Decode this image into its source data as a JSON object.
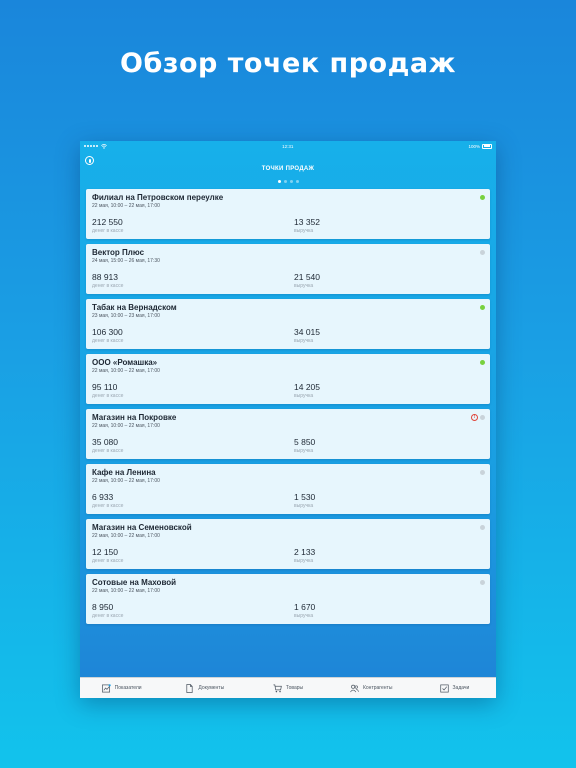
{
  "headline": "Обзор точек продаж",
  "status_bar": {
    "carrier_dots": 5,
    "time": "12:31",
    "battery": "100%"
  },
  "nav": {
    "title": "ТОЧКИ ПРОДАЖ",
    "pages": 4,
    "active_page": 1
  },
  "labels": {
    "cash": "денег в кассе",
    "revenue": "выручка"
  },
  "points": [
    {
      "name": "Филиал на Петровском переулке",
      "period": "22 мая, 10:00 – 22 мая, 17:00",
      "cash": "212 550",
      "revenue": "13 352",
      "status": "online",
      "warning": false
    },
    {
      "name": "Вектор Плюс",
      "period": "24 мая, 15:00 – 26 мая, 17:30",
      "cash": "88 913",
      "revenue": "21 540",
      "status": "offline",
      "warning": false
    },
    {
      "name": "Табак на Вернадском",
      "period": "23 мая, 10:00 – 23 мая, 17:00",
      "cash": "106 300",
      "revenue": "34 015",
      "status": "online",
      "warning": false
    },
    {
      "name": "ООО «Ромашка»",
      "period": "22 мая, 10:00 – 22 мая, 17:00",
      "cash": "95 110",
      "revenue": "14 205",
      "status": "online",
      "warning": false
    },
    {
      "name": "Магазин на Покровке",
      "period": "22 мая, 10:00 – 22 мая, 17:00",
      "cash": "35 080",
      "revenue": "5 850",
      "status": "offline",
      "warning": true
    },
    {
      "name": "Кафе на Ленина",
      "period": "22 мая, 10:00 – 22 мая, 17:00",
      "cash": "6 933",
      "revenue": "1 530",
      "status": "offline",
      "warning": false
    },
    {
      "name": "Магазин на Семеновской",
      "period": "22 мая, 10:00 – 22 мая, 17:00",
      "cash": "12 150",
      "revenue": "2 133",
      "status": "offline",
      "warning": false
    },
    {
      "name": "Сотовые на Маховой",
      "period": "22 мая, 10:00 – 22 мая, 17:00",
      "cash": "8 950",
      "revenue": "1 670",
      "status": "offline",
      "warning": false
    }
  ],
  "tabs": [
    {
      "label": "Показатели",
      "icon": "chart-icon"
    },
    {
      "label": "Документы",
      "icon": "document-icon"
    },
    {
      "label": "Товары",
      "icon": "cart-icon"
    },
    {
      "label": "Контрагенты",
      "icon": "people-icon"
    },
    {
      "label": "Задачи",
      "icon": "tasks-icon"
    }
  ],
  "colors": {
    "online": "#78d13f",
    "offline": "#c9d3da",
    "warning": "#e0463c"
  }
}
